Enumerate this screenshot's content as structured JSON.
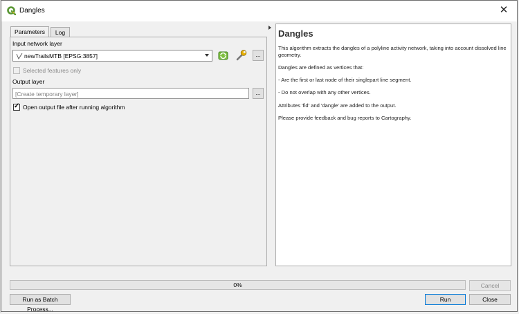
{
  "window": {
    "title": "Dangles"
  },
  "tabs": [
    {
      "label": "Parameters",
      "active": true
    },
    {
      "label": "Log",
      "active": false
    }
  ],
  "params": {
    "input_label": "Input network layer",
    "input_value": "newTrailsMTB [EPSG:3857]",
    "selected_only_label": "Selected features only",
    "selected_only_checked": false,
    "output_label": "Output layer",
    "output_placeholder": "[Create temporary layer]",
    "open_output_label": "Open output file after running algorithm",
    "open_output_checked": true,
    "browse_label": "..."
  },
  "help": {
    "title": "Dangles",
    "paragraphs": [
      "This algorithm extracts the dangles of a polyline activity network, taking into account dissolved line geometry.",
      "Dangles are defined as vertices that:",
      "- Are the first or last node of their singlepart line segment.",
      "- Do not overlap with any other vertices.",
      "Attributes 'fid' and 'dangle' are added to the output.",
      "Please provide feedback and bug reports to Cartography."
    ]
  },
  "progress": {
    "value": 0,
    "text": "0%"
  },
  "buttons": {
    "cancel": "Cancel",
    "batch": "Run as Batch Process...",
    "run": "Run",
    "close": "Close"
  },
  "colors": {
    "accent": "#0078d7",
    "qgis_green": "#589632"
  }
}
